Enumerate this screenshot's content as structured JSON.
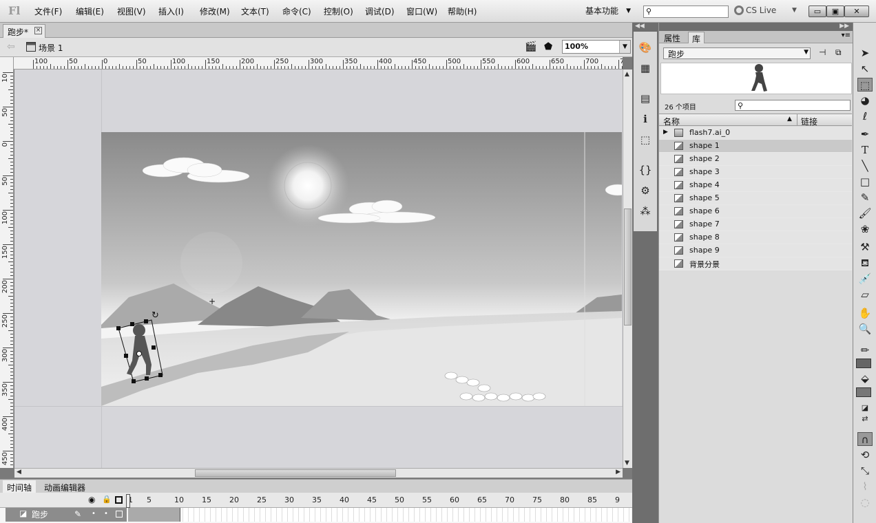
{
  "app": {
    "logo": "Fl"
  },
  "menu": [
    "文件(F)",
    "编辑(E)",
    "视图(V)",
    "插入(I)",
    "修改(M)",
    "文本(T)",
    "命令(C)",
    "控制(O)",
    "调试(D)",
    "窗口(W)",
    "帮助(H)"
  ],
  "workspace": "基本功能",
  "cslive": "CS Live",
  "window_buttons": [
    "▭",
    "▣",
    "✕"
  ],
  "document": {
    "tab": "跑步*",
    "scene": "场景 1",
    "zoom": "100%"
  },
  "ruler_h": [
    "100",
    "50",
    "0",
    "50",
    "100",
    "150",
    "200",
    "250",
    "300",
    "350",
    "400",
    "450",
    "500",
    "550",
    "600",
    "650",
    "700",
    "750"
  ],
  "ruler_v": [
    "10",
    "50",
    "0",
    "50",
    "100",
    "150",
    "200",
    "250",
    "300",
    "350",
    "400",
    "450"
  ],
  "timeline": {
    "tabs": [
      "时间轴",
      "动画编辑器"
    ],
    "frames": [
      "1",
      "5",
      "10",
      "15",
      "20",
      "25",
      "30",
      "35",
      "40",
      "45",
      "50",
      "55",
      "60",
      "65",
      "70",
      "75",
      "80",
      "85",
      "9"
    ],
    "layer": "跑步"
  },
  "panel": {
    "tabs": [
      "属性",
      "库"
    ],
    "library_select": "跑步",
    "item_count": "26 个项目",
    "col_name": "名称",
    "col_link": "链接"
  },
  "library_items": [
    {
      "name": "flash7.ai_0",
      "type": "folder"
    },
    {
      "name": "shape 1",
      "type": "graphic",
      "selected": true
    },
    {
      "name": "shape 2",
      "type": "graphic"
    },
    {
      "name": "shape 3",
      "type": "graphic"
    },
    {
      "name": "shape 4",
      "type": "graphic"
    },
    {
      "name": "shape 5",
      "type": "graphic"
    },
    {
      "name": "shape 6",
      "type": "graphic"
    },
    {
      "name": "shape 7",
      "type": "graphic"
    },
    {
      "name": "shape 8",
      "type": "graphic"
    },
    {
      "name": "shape 9",
      "type": "graphic"
    },
    {
      "name": "背景分景",
      "type": "graphic"
    }
  ]
}
